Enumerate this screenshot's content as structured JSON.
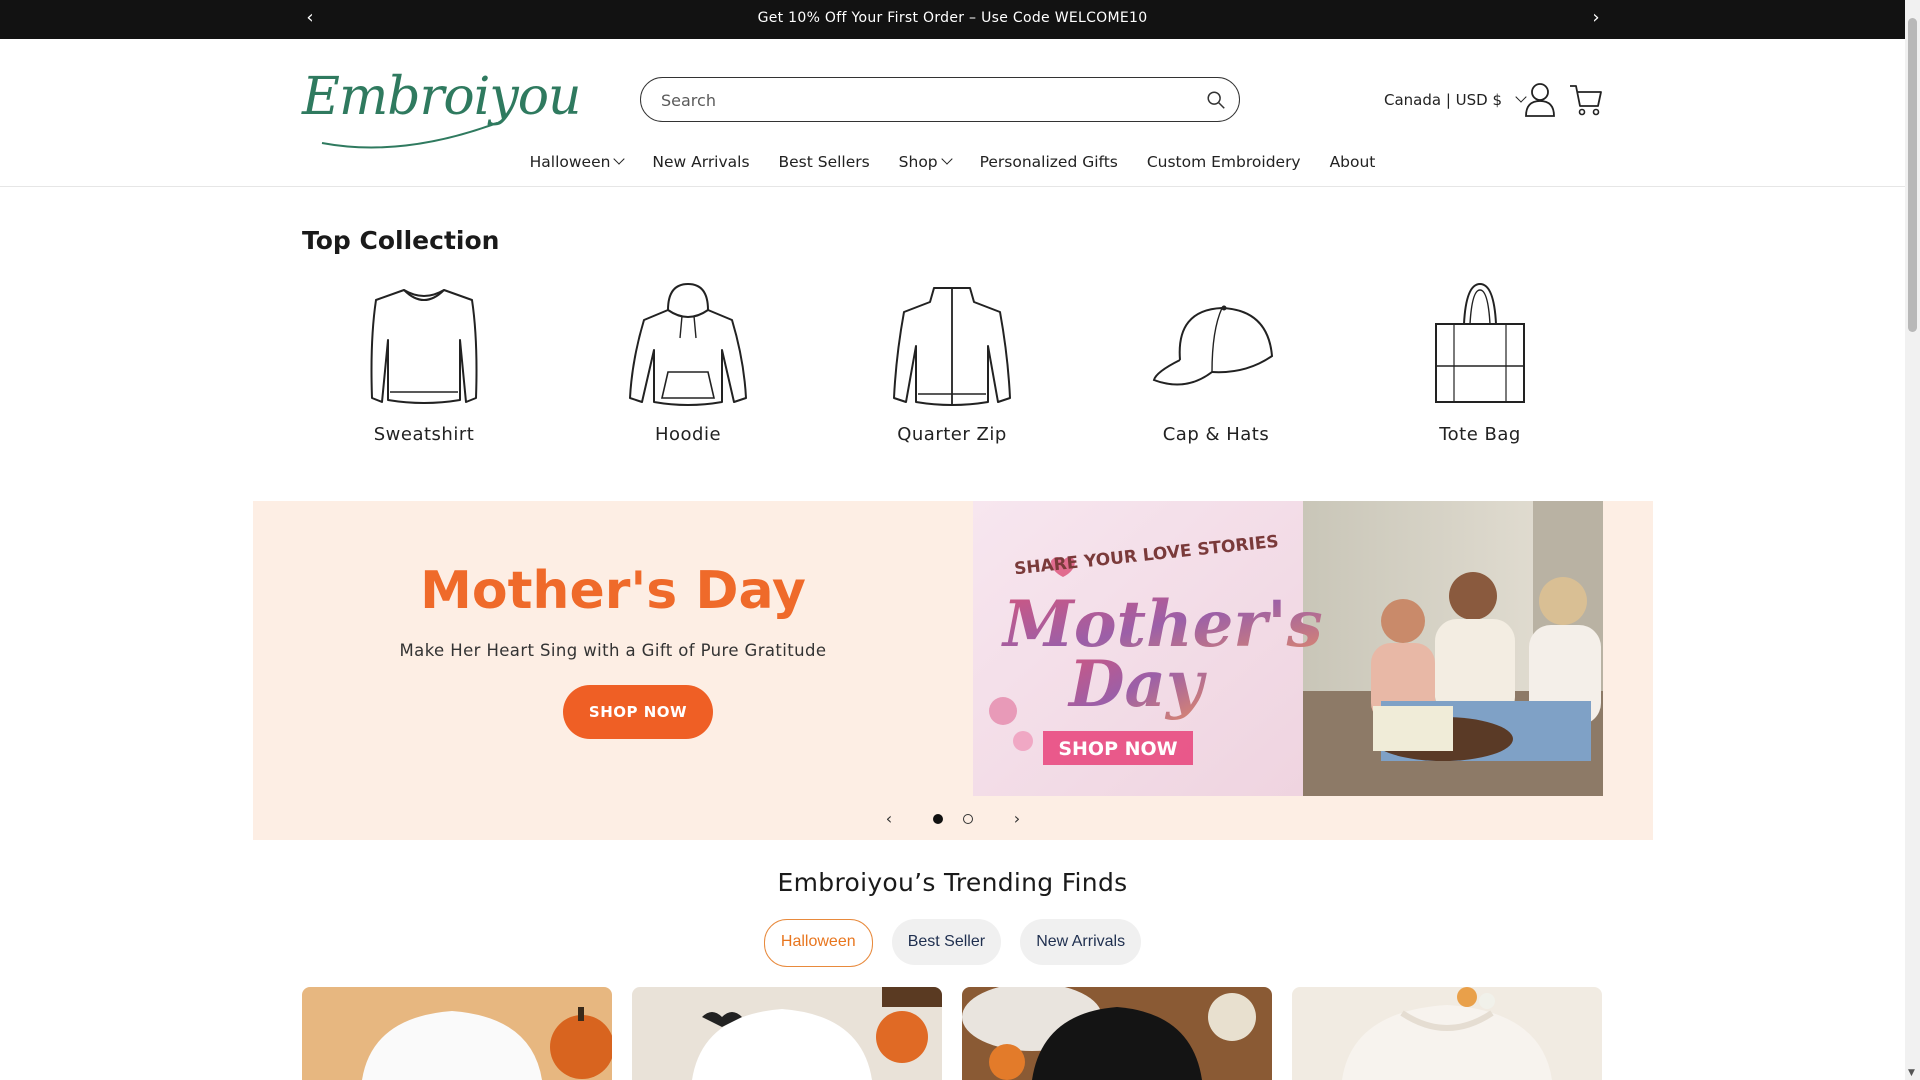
{
  "announcement": {
    "text": "Get 10% Off Your First Order – Use Code WELCOME10",
    "prev_icon": "chevron-left-icon",
    "next_icon": "chevron-right-icon"
  },
  "header": {
    "logo_text": "Embroiyou",
    "search_placeholder": "Search",
    "country": "Canada | USD $",
    "nav": [
      "Halloween",
      "New Arrivals",
      "Best Sellers",
      "Shop",
      "Personalized Gifts",
      "Custom Embroidery",
      "About"
    ]
  },
  "top_collection": {
    "title": "Top Collection",
    "items": [
      "Sweatshirt",
      "Hoodie",
      "Quarter Zip",
      "Cap & Hats",
      "Tote Bag"
    ]
  },
  "banner": {
    "title": "Mother's Day",
    "subtitle": "Make Her Heart Sing with a Gift of Pure Gratitude",
    "button": "SHOP NOW",
    "image_text_top": "SHARE YOUR LOVE STORIES",
    "image_text_title1": "Mother's",
    "image_text_title2": "Day",
    "image_button": "SHOP NOW",
    "slides_total": 2,
    "active_slide": 1
  },
  "trending": {
    "title": "Embroiyou’s Trending Finds",
    "tabs": [
      "Halloween",
      "Best Seller",
      "New Arrivals"
    ],
    "active_tab": "Halloween"
  },
  "colors": {
    "accent_orange": "#ef5f25",
    "brand_green": "#2f7a5f",
    "banner_bg": "#fdeee4",
    "announcement_bg": "#121212"
  }
}
